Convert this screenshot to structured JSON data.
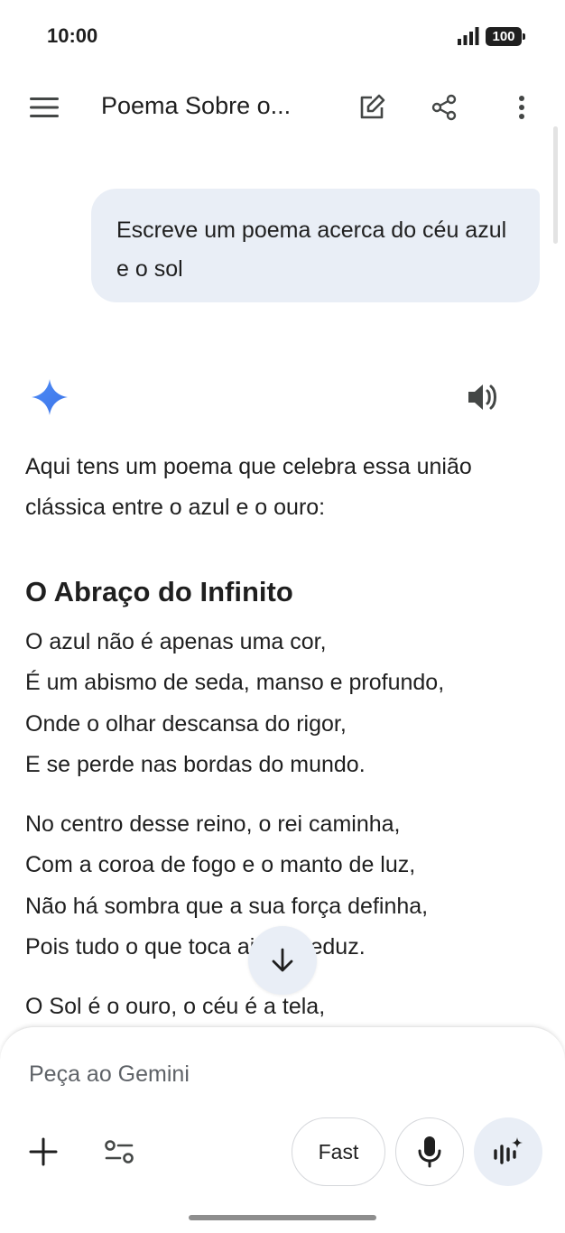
{
  "status_bar": {
    "time": "10:00",
    "battery": "100"
  },
  "app_bar": {
    "title": "Poema Sobre o..."
  },
  "chat": {
    "user_message": "Escreve um poema acerca do céu azul e o sol",
    "response": {
      "intro": "Aqui tens um poema que celebra essa união clássica entre o azul e o ouro:",
      "poem_title": "O Abraço do Infinito",
      "stanzas": [
        [
          "O azul não é apenas uma cor,",
          "É um abismo de seda, manso e profundo,",
          "Onde o olhar descansa do rigor,",
          "E se perde nas bordas do mundo."
        ],
        [
          "No centro desse reino, o rei caminha,",
          "Com a coroa de fogo e o manto de luz,",
          "Não há sombra que a sua força definha,",
          "Pois tudo o que toca ainda seduz."
        ],
        [
          "O Sol é o ouro, o céu é a tela,"
        ]
      ]
    }
  },
  "composer": {
    "placeholder": "Peça ao Gemini",
    "mode_label": "Fast"
  },
  "colors": {
    "bubble": "#e9eef6",
    "gemini_star": "#4285f4",
    "text": "#1f1f1f",
    "muted": "#5f6368"
  },
  "icons": [
    "menu-icon",
    "edit-icon",
    "share-icon",
    "more-vert-icon",
    "gemini-star-icon",
    "speaker-icon",
    "arrow-down-icon",
    "plus-icon",
    "tools-icon",
    "mic-icon",
    "live-icon"
  ]
}
